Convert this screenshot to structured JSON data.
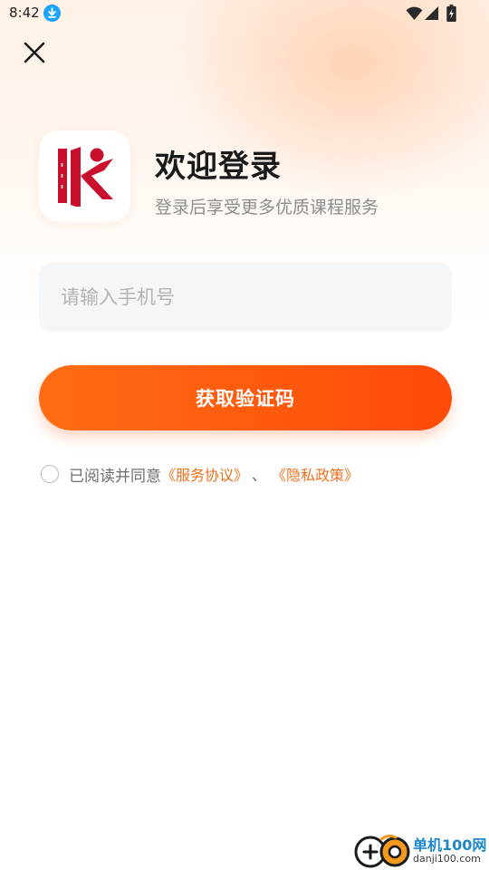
{
  "status_bar": {
    "time": "8:42",
    "icons": [
      "download-icon",
      "wifi-icon",
      "signal-icon",
      "battery-icon"
    ]
  },
  "header": {
    "close_icon": "close-icon"
  },
  "welcome": {
    "title": "欢迎登录",
    "subtitle": "登录后享受更多优质课程服务"
  },
  "login_form": {
    "phone_placeholder": "请输入手机号",
    "phone_value": "",
    "submit_label": "获取验证码"
  },
  "agreement": {
    "checked": false,
    "prefix": "已阅读并同意",
    "service_link": "《服务协议》",
    "separator": "、",
    "privacy_link": "《隐私政策》"
  },
  "watermark": {
    "title": "单机100网",
    "url": "danji100.com"
  },
  "colors": {
    "accent": "#ff5a0c",
    "link": "#f0701d",
    "logo_red": "#c8102e",
    "status_download": "#1aa3ff"
  }
}
